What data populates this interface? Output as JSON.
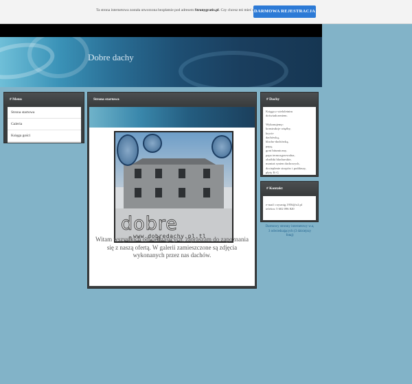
{
  "promo": {
    "message_prefix": "Ta strona internetowa została utworzona bezpłatnie pod adresem ",
    "message_brand": "Stronygratis.pl",
    "message_suffix": ". Czy chcesz też mieć własną stronę?",
    "cta_label": "DARMOWA REJESTRACJA"
  },
  "site": {
    "title": "Dobre dachy"
  },
  "menu": {
    "title": "# Menu",
    "items": [
      "Strona startowa",
      "Galeria",
      "Księga gości"
    ]
  },
  "main": {
    "title": "Strona startowa",
    "photo_brand": "dobre dachy",
    "photo_url": "www.dobredachy.pl.tl",
    "welcome": "Witam wszystkich odwiedzających, zapraszam do zapoznania się z naszą ofertą. W galerii zamieszczone są zdjęcia wykonanych przez nas dachów."
  },
  "dachy": {
    "title": "# Dachy",
    "intro": "Księga z wieloletnim doświadczeniem.",
    "list_heading": "Wykonujemy:",
    "items": [
      "konstrukcje więźby,",
      "krycie",
      "dachówką,",
      "blacho-dachówką,",
      "papą,",
      "gont bitumiczny,",
      "papa termozgrzewalna,",
      "obróbki blacharskie,",
      "montaż rynien dachowych,",
      "docieplenie stropów i poddaszy,",
      "płyty K-G"
    ]
  },
  "kontakt": {
    "title": "# Kontakt",
    "email": "e-mail: roysmig.1956@o2.pl",
    "phone": "telefon: 5 602 096 820"
  },
  "footer": {
    "note": "Darmowy stronny internetowy w.a, 3 odwiedzających (3 dzisiejszy fotaj)"
  },
  "colors": {
    "page_bg": "#82b3c8",
    "box_bg": "#3a3d3e",
    "cta": "#2c7ad6"
  }
}
